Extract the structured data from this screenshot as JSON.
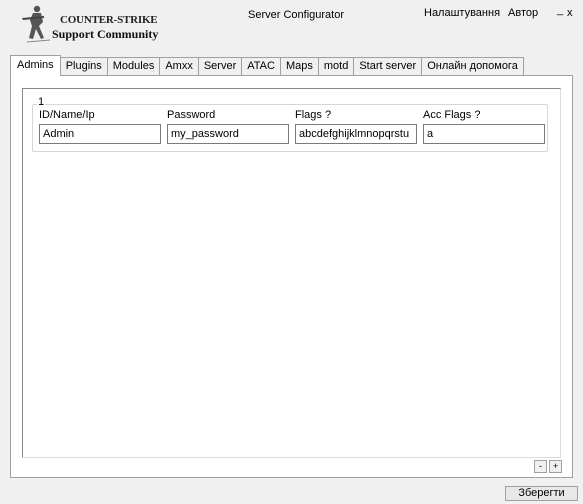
{
  "header": {
    "logo_line1": "COUNTER-STRIKE",
    "logo_line2": "Support Community",
    "app_title": "Server Configurator",
    "menu_settings": "Налаштування",
    "menu_author": "Автор",
    "minimize": "_",
    "close": "x"
  },
  "tabs": [
    {
      "label": "Admins",
      "active": true
    },
    {
      "label": "Plugins"
    },
    {
      "label": "Modules"
    },
    {
      "label": "Amxx"
    },
    {
      "label": "Server"
    },
    {
      "label": "ATAC"
    },
    {
      "label": "Maps"
    },
    {
      "label": "motd"
    },
    {
      "label": "Start server"
    },
    {
      "label": "Онлайн допомога"
    }
  ],
  "admins": {
    "entry_caption": "1",
    "columns": {
      "id_label": "ID/Name/Ip",
      "password_label": "Password",
      "flags_label": "Flags  ?",
      "acc_flags_label": "Acc Flags  ?"
    },
    "entry": {
      "id": "Admin",
      "password": "my_password",
      "flags": "abcdefghijklmnopqrstu",
      "acc_flags": "a"
    }
  },
  "controls": {
    "remove_label": "-",
    "add_label": "+",
    "save_label": "Зберегти"
  }
}
